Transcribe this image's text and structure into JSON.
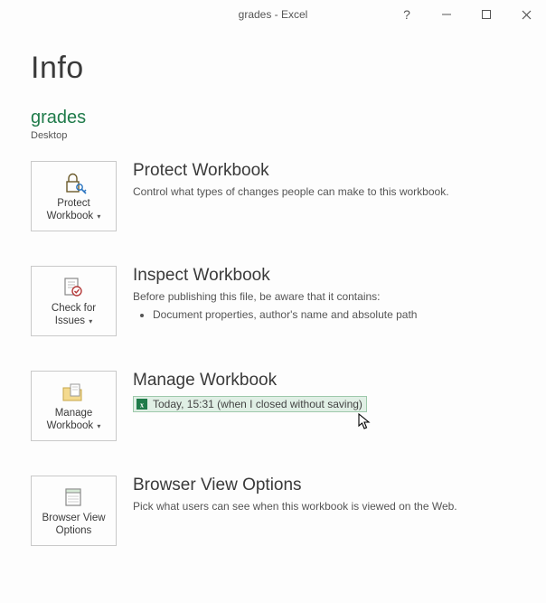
{
  "window": {
    "title": "grades - Excel"
  },
  "page": {
    "title": "Info",
    "doc_name": "grades",
    "doc_location": "Desktop"
  },
  "sections": {
    "protect": {
      "tile_label": "Protect\nWorkbook",
      "heading": "Protect Workbook",
      "desc": "Control what types of changes people can make to this workbook."
    },
    "inspect": {
      "tile_label": "Check for\nIssues",
      "heading": "Inspect Workbook",
      "desc": "Before publishing this file, be aware that it contains:",
      "items": [
        "Document properties, author's name and absolute path"
      ]
    },
    "manage": {
      "tile_label": "Manage\nWorkbook",
      "heading": "Manage Workbook",
      "version": "Today, 15:31 (when I closed without saving)"
    },
    "browser": {
      "tile_label": "Browser View\nOptions",
      "heading": "Browser View Options",
      "desc": "Pick what users can see when this workbook is viewed on the Web."
    }
  }
}
